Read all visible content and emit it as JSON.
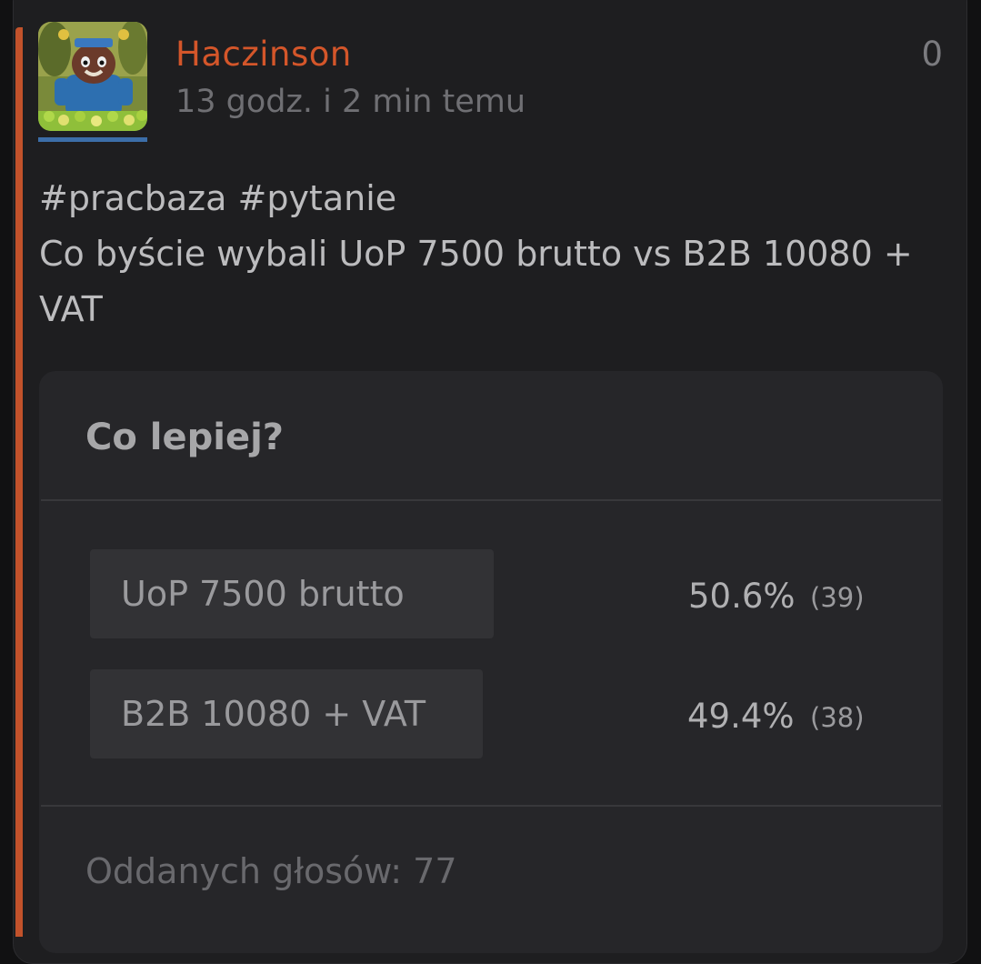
{
  "post": {
    "author": "Haczinson",
    "time": "13 godz. i 2 min temu",
    "votes": "0",
    "tags": "#pracbaza #pytanie",
    "text": "Co byście wybali UoP 7500 brutto vs B2B 10080 + VAT"
  },
  "poll": {
    "title": "Co lepiej?",
    "options": [
      {
        "label": "UoP 7500 brutto",
        "percent": "50.6%",
        "count": "(39)"
      },
      {
        "label": "B2B 10080 + VAT",
        "percent": "49.4%",
        "count": "(38)"
      }
    ],
    "total": "Oddanych głosów: 77"
  },
  "colors": {
    "accent": "#c2522b",
    "author": "#d4562a",
    "avatar_underline": "#3c6ea8"
  },
  "icons": {
    "avatar": "cartoon-avatar"
  }
}
